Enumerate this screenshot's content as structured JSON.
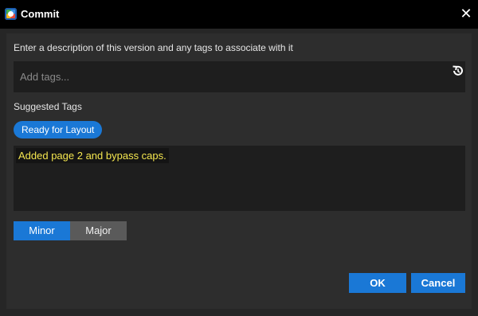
{
  "window": {
    "title": "Commit"
  },
  "main": {
    "description": "Enter a description of this version and any tags to associate with it",
    "tags_placeholder": "Add tags...",
    "suggested_label": "Suggested Tags",
    "suggested_tags": [
      "Ready for Layout"
    ],
    "comment_text": "Added page 2 and bypass caps.",
    "version_options": [
      "Minor",
      "Major"
    ],
    "selected_version": "Minor"
  },
  "buttons": {
    "ok": "OK",
    "cancel": "Cancel"
  },
  "colors": {
    "accent": "#1a78d6",
    "titlebar": "#000000",
    "background": "#262626",
    "highlight_text": "#f4e64f"
  },
  "icons": {
    "app": "app-logo-icon",
    "close": "close-icon",
    "history": "history-icon"
  }
}
